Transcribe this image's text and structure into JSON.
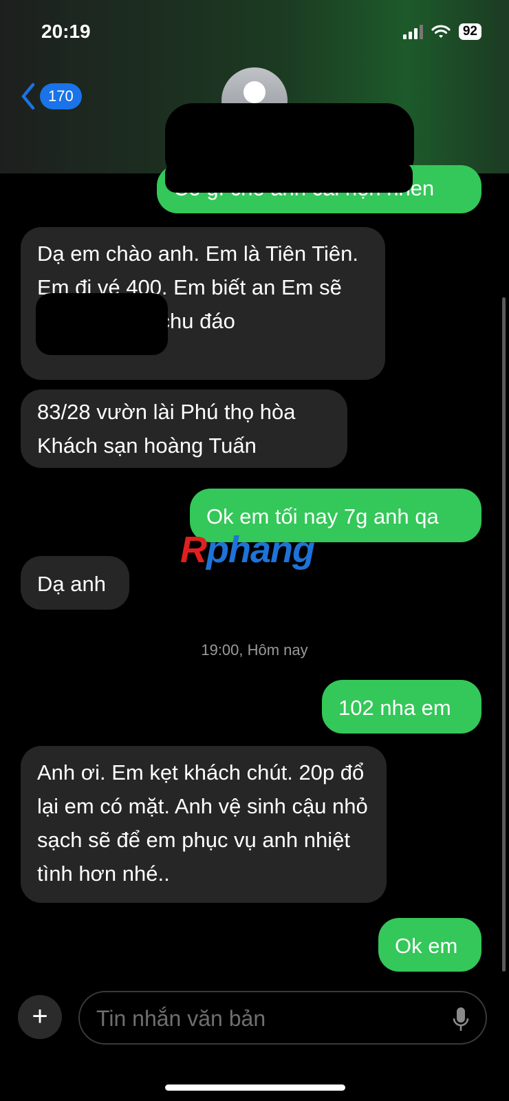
{
  "status": {
    "time": "20:19",
    "battery": "92"
  },
  "header": {
    "back_count": "170"
  },
  "messages": [
    {
      "dir": "out",
      "text": "Có gì cho anh cái hẹn nhen"
    },
    {
      "dir": "in",
      "text": "Dạ em chào anh. Em là Tiên Tiên. Em đi vé 400. Em biết an Em sẽ phục vụ anh chu đáo"
    },
    {
      "dir": "in",
      "text": "83/28 vườn lài Phú thọ hòa Khách sạn hoàng Tuấn"
    },
    {
      "dir": "out",
      "text": "Ok em tối nay 7g anh qa"
    },
    {
      "dir": "in",
      "text": "Dạ anh"
    },
    {
      "dir": "out",
      "text": "102 nha em"
    },
    {
      "dir": "in",
      "text": "Anh ơi. Em kẹt khách chút. 20p đổ lại em có mặt. Anh vệ sinh cậu nhỏ sạch sẽ để em phục vụ anh nhiệt tình hơn nhé.."
    },
    {
      "dir": "out",
      "text": "Ok em"
    }
  ],
  "timestamp": "19:00, Hôm nay",
  "watermark": {
    "part1": "R",
    "part2": "phang"
  },
  "composer": {
    "placeholder": "Tin nhắn văn bản",
    "plus": "+"
  },
  "colors": {
    "incoming": "#262626",
    "outgoing": "#34c759",
    "accent": "#1a73e8"
  },
  "icons": {
    "back": "chevron-left-icon",
    "mic": "microphone-icon",
    "plus": "plus-icon",
    "wifi": "wifi-icon"
  }
}
